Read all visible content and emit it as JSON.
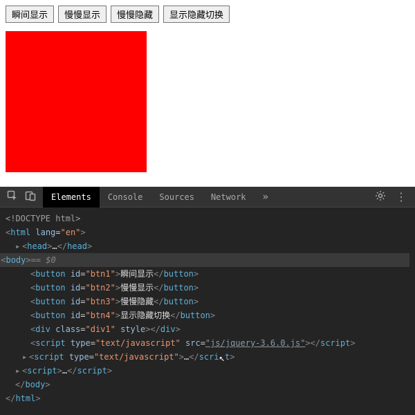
{
  "buttons": {
    "btn1": "瞬间显示",
    "btn2": "慢慢显示",
    "btn3": "慢慢隐藏",
    "btn4": "显示隐藏切换"
  },
  "redbox_color": "#ff0000",
  "devtools": {
    "tabs": {
      "elements": "Elements",
      "console": "Console",
      "sources": "Sources",
      "network": "Network"
    },
    "overflow": "»",
    "gear": "⚙",
    "menu": "⋮",
    "selection_tag": "body",
    "selection_repr": " == $0",
    "dots": "⋯",
    "code": {
      "doctype": "<!DOCTYPE html>",
      "html_open_pre": "<",
      "html_tag": "html",
      "lang_attr": " lang",
      "eq": "=",
      "lang_val": "\"en\"",
      "html_open_post": ">",
      "head_open": "<head>",
      "head_ell": "…",
      "head_close": "</head>",
      "body_open": "<body>",
      "btn_open": "<button ",
      "id_attr": "id",
      "btn1_id": "\"btn1\"",
      "btn2_id": "\"btn2\"",
      "btn3_id": "\"btn3\"",
      "btn4_id": "\"btn4\"",
      "btn_close": "</button>",
      "div_open": "<div ",
      "class_attr": "class",
      "div_class": "\"div1\"",
      "style_attr": " style",
      "div_close_self": "></div>",
      "script_open": "<script ",
      "type_attr": "type",
      "type_val": "\"text/javascript\"",
      "src_attr": " src",
      "src_val": "\"js/jquery-3.6.0.js\"",
      "script_close_empty": "></",
      "script_tag": "script",
      "gt": ">",
      "script_open2": "<script ",
      "script_ell": ">…</",
      "script_close2": "script>",
      "body_close": "</body>",
      "html_close": "</html>",
      "arrow_right": "▸",
      "arrow_down": "▾"
    }
  }
}
